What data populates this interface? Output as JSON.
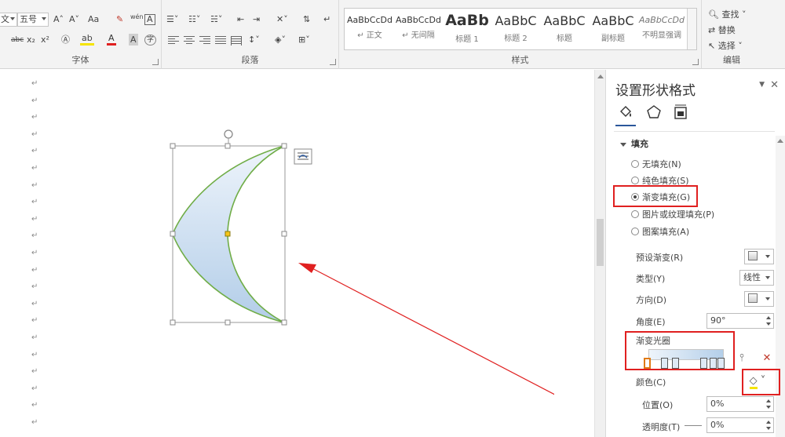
{
  "ribbon": {
    "font_group": {
      "label": "字体",
      "font_name": "文",
      "font_size": "五号",
      "grow_font": "A˄",
      "shrink_font": "A˅",
      "change_case": "Aa",
      "wen": "wén",
      "char_border": "A",
      "strike": "abc",
      "sub": "x₂",
      "sup": "x²",
      "highlight": "ab",
      "font_color": "A",
      "shade": "A",
      "enclose": "字"
    },
    "paragraph_group": {
      "label": "段落"
    },
    "styles_group": {
      "label": "样式",
      "items": [
        {
          "sample": "AaBbCcDd",
          "name": "↵ 正文"
        },
        {
          "sample": "AaBbCcDd",
          "name": "↵ 无间隔"
        },
        {
          "sample": "AaBb",
          "name": "标题 1"
        },
        {
          "sample": "AaBbC",
          "name": "标题 2"
        },
        {
          "sample": "AaBbC",
          "name": "标题"
        },
        {
          "sample": "AaBbC",
          "name": "副标题"
        },
        {
          "sample": "AaBbCcDd",
          "name": "不明显强调"
        }
      ]
    },
    "editing_group": {
      "label": "编辑",
      "find": "查找",
      "replace": "替换",
      "select": "选择"
    }
  },
  "document": {
    "paragraph_mark": "↵",
    "shape_fill_top": "#eef4fb",
    "shape_fill_bottom": "#b2cde8",
    "shape_outline": "#70ad47",
    "arrow_color": "#e02020"
  },
  "pane": {
    "title": "设置形状格式",
    "pin": "▼",
    "close": "✕",
    "section_fill": "填充",
    "fill_options": [
      {
        "label": "无填充(N)",
        "selected": false
      },
      {
        "label": "纯色填充(S)",
        "selected": false
      },
      {
        "label": "渐变填充(G)",
        "selected": true
      },
      {
        "label": "图片或纹理填充(P)",
        "selected": false
      },
      {
        "label": "图案填充(A)",
        "selected": false
      }
    ],
    "preset_gradient": "预设渐变(R)",
    "type_label": "类型(Y)",
    "type_value": "线性",
    "direction_label": "方向(D)",
    "angle_label": "角度(E)",
    "angle_value": "90°",
    "gradient_stops_label": "渐变光圈",
    "color_label": "颜色(C)",
    "position_label": "位置(O)",
    "position_value": "0%",
    "transparency_label": "透明度(T)",
    "transparency_value": "0%",
    "highlight_color": "#e02020"
  }
}
